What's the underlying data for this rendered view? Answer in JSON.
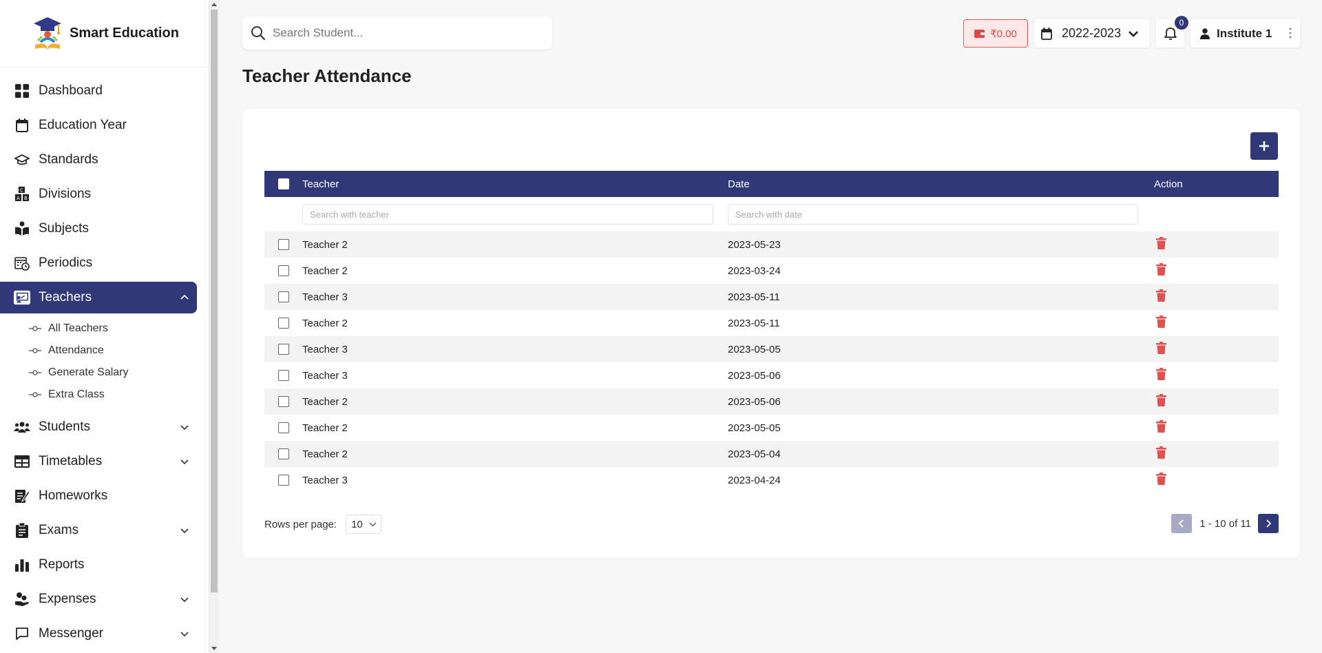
{
  "brand": {
    "name": "Smart Education"
  },
  "search": {
    "placeholder": "Search Student..."
  },
  "header": {
    "wallet": "₹0.00",
    "year": "2022-2023",
    "notifications": "0",
    "user": "Institute 1"
  },
  "sidebar": {
    "items": [
      {
        "label": "Dashboard",
        "icon": "dashboard-icon"
      },
      {
        "label": "Education Year",
        "icon": "calendar-icon"
      },
      {
        "label": "Standards",
        "icon": "graduation-cap-icon"
      },
      {
        "label": "Divisions",
        "icon": "abc-blocks-icon"
      },
      {
        "label": "Subjects",
        "icon": "book-reader-icon"
      },
      {
        "label": "Periodics",
        "icon": "calendar-clock-icon"
      },
      {
        "label": "Teachers",
        "icon": "teacher-board-icon",
        "active": true
      },
      {
        "label": "Students",
        "icon": "students-icon"
      },
      {
        "label": "Timetables",
        "icon": "table-icon"
      },
      {
        "label": "Homeworks",
        "icon": "homework-icon"
      },
      {
        "label": "Exams",
        "icon": "clipboard-icon"
      },
      {
        "label": "Reports",
        "icon": "bar-chart-icon"
      },
      {
        "label": "Expenses",
        "icon": "hand-coins-icon"
      },
      {
        "label": "Messenger",
        "icon": "message-icon"
      }
    ],
    "teacher_sub": [
      "All Teachers",
      "Attendance",
      "Generate Salary",
      "Extra Class"
    ]
  },
  "page": {
    "title": "Teacher Attendance"
  },
  "table": {
    "headers": {
      "teacher": "Teacher",
      "date": "Date",
      "action": "Action"
    },
    "filters": {
      "teacher": "Search with teacher",
      "date": "Search with date"
    },
    "rows": [
      {
        "teacher": "Teacher 2",
        "date": "2023-05-23"
      },
      {
        "teacher": "Teacher 2",
        "date": "2023-03-24"
      },
      {
        "teacher": "Teacher 3",
        "date": "2023-05-11"
      },
      {
        "teacher": "Teacher 2",
        "date": "2023-05-11"
      },
      {
        "teacher": "Teacher 3",
        "date": "2023-05-05"
      },
      {
        "teacher": "Teacher 3",
        "date": "2023-05-06"
      },
      {
        "teacher": "Teacher 2",
        "date": "2023-05-06"
      },
      {
        "teacher": "Teacher 2",
        "date": "2023-05-05"
      },
      {
        "teacher": "Teacher 2",
        "date": "2023-05-04"
      },
      {
        "teacher": "Teacher 3",
        "date": "2023-04-24"
      }
    ]
  },
  "pagination": {
    "rows_label": "Rows per page:",
    "rows_value": "10",
    "range": "1 - 10 of 11"
  },
  "colors": {
    "primary": "#303877",
    "danger": "#e05252",
    "wallet_bg": "#fde8e8"
  }
}
